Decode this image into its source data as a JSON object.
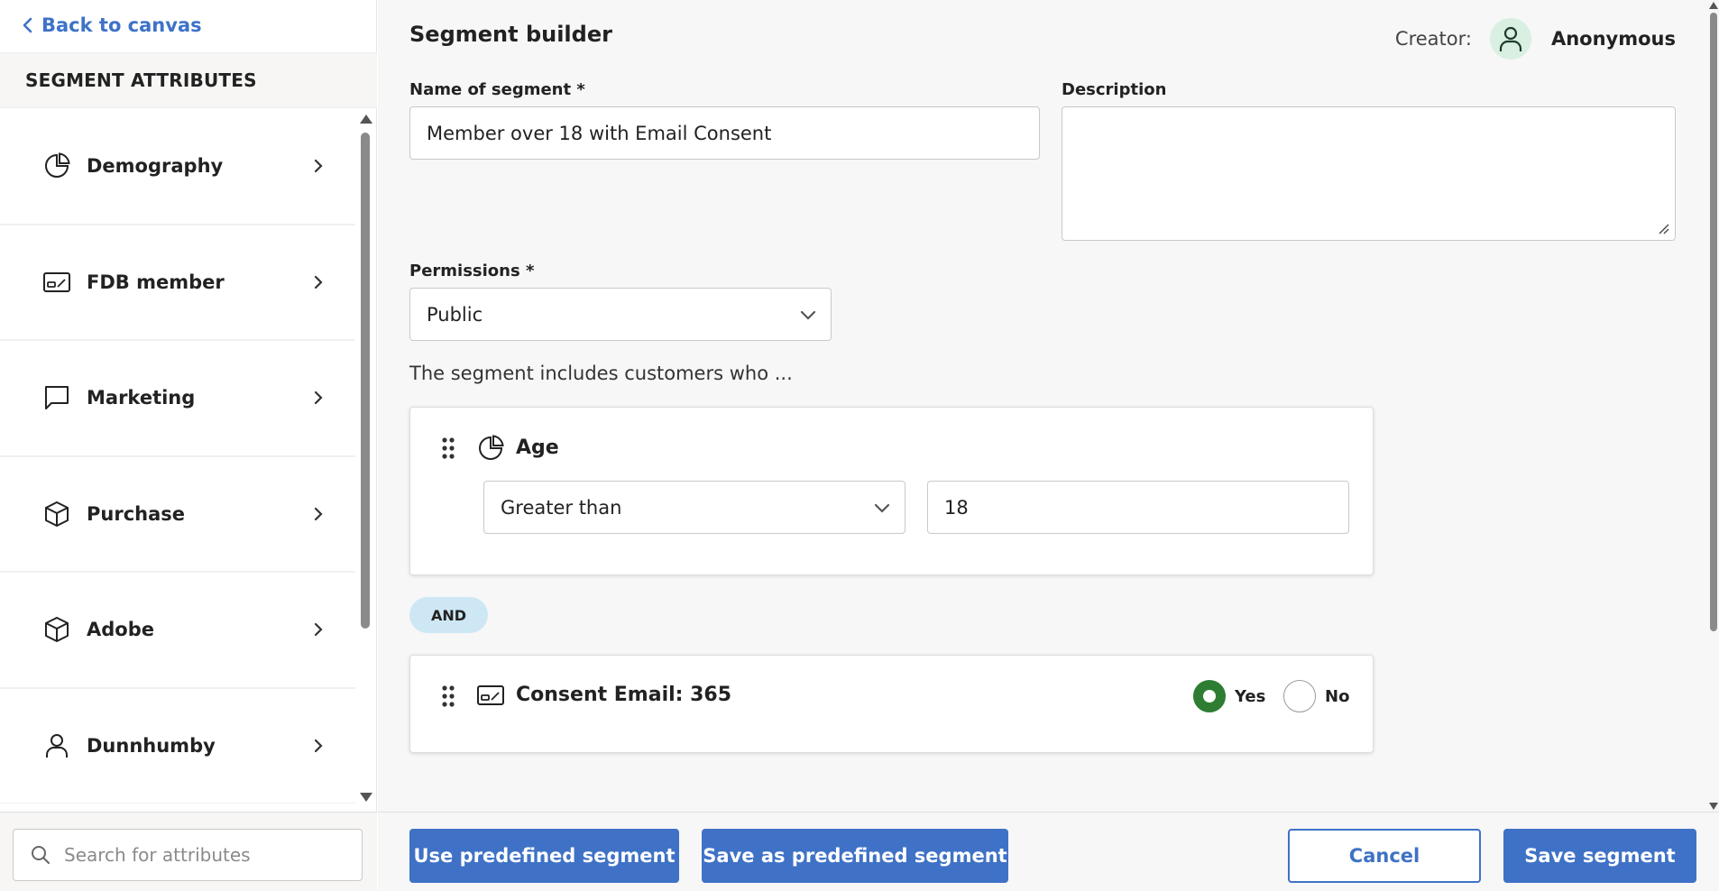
{
  "sidebar": {
    "back_label": "Back to canvas",
    "header": "SEGMENT ATTRIBUTES",
    "items": [
      {
        "label": "Demography",
        "icon": "pie-chart-icon"
      },
      {
        "label": "FDB member",
        "icon": "member-card-icon"
      },
      {
        "label": "Marketing",
        "icon": "chat-bubble-icon"
      },
      {
        "label": "Purchase",
        "icon": "box-icon"
      },
      {
        "label": "Adobe",
        "icon": "box-icon"
      },
      {
        "label": "Dunnhumby",
        "icon": "person-icon"
      }
    ],
    "search_placeholder": "Search for attributes"
  },
  "main": {
    "title": "Segment builder",
    "creator_label": "Creator:",
    "creator_name": "Anonymous",
    "name_label": "Name of segment *",
    "name_value": "Member over 18 with Email Consent",
    "description_label": "Description",
    "description_value": "",
    "permissions_label": "Permissions *",
    "permissions_value": "Public",
    "includes_text": "The segment includes customers who ...",
    "conditions": [
      {
        "title": "Age",
        "icon": "pie-chart-icon",
        "operator": "Greater than",
        "value": "18"
      },
      {
        "title": "Consent Email: 365",
        "icon": "member-card-icon",
        "options": [
          "Yes",
          "No"
        ],
        "selected": "Yes"
      }
    ],
    "logic_operator": "AND"
  },
  "footer": {
    "use_predefined": "Use predefined segment",
    "save_predefined": "Save as predefined segment",
    "cancel": "Cancel",
    "save": "Save segment"
  },
  "colors": {
    "accent": "#3f72c6",
    "selected_radio": "#2e7d32",
    "and_pill": "#cde7f4",
    "avatar_bg": "#d9efe2"
  }
}
